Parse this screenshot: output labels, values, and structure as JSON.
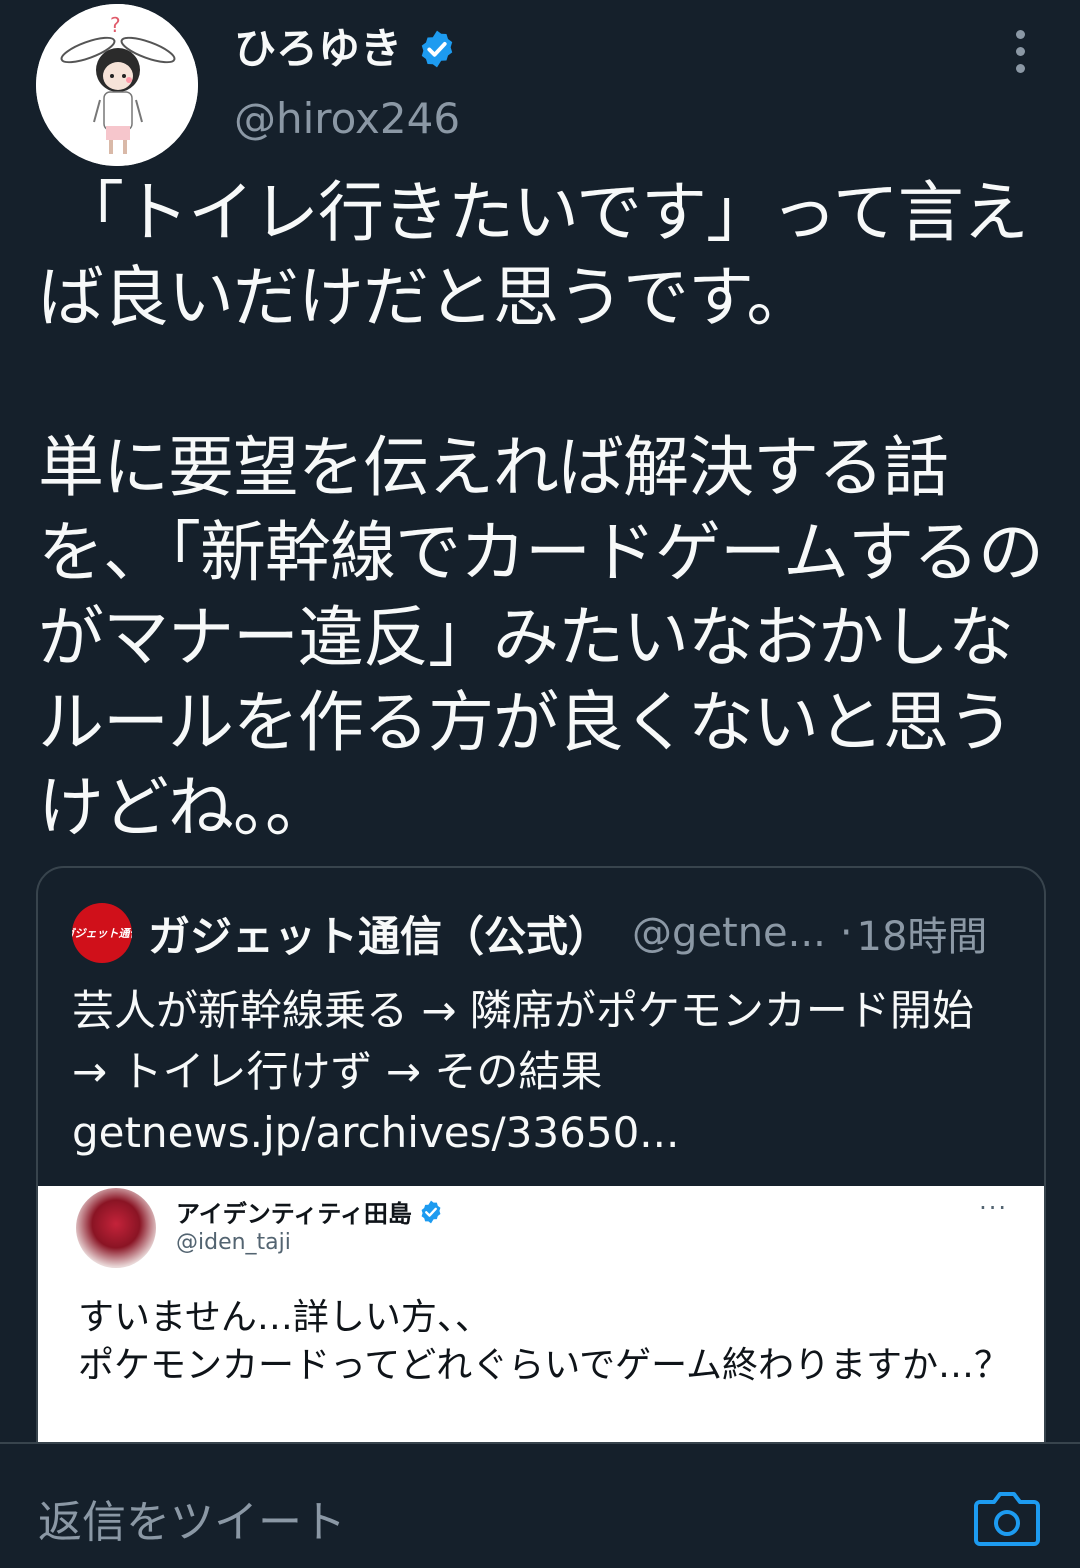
{
  "author": {
    "display_name": "ひろゆき",
    "handle": "@hirox246",
    "verified": true
  },
  "tweet": {
    "text": " 「トイレ行きたいです」って言えば良いだけだと思うです。\n\n単に要望を伝えれば解決する話を、「新幹線でカードゲームするのがマナー違反」みたいなおかしなルールを作る方が良くないと思うけどね。。"
  },
  "quote": {
    "avatar_text": "ガジェット通信",
    "display_name": "ガジェット通信（公式）",
    "handle": "@getne...",
    "separator": "·",
    "time": "18時間",
    "text": "芸人が新幹線乗る → 隣席がポケモンカード開始 → トイレ行けず → その結果 getnews.jp/archives/33650...",
    "image": {
      "display_name": "アイデンティティ田島",
      "handle": "@iden_taji",
      "more": "···",
      "text": "すいません…詳しい方、、\nポケモンカードってどれぐらいでゲーム終わりますか…？"
    }
  },
  "reply": {
    "placeholder": "返信をツイート"
  },
  "colors": {
    "background": "#15202b",
    "text": "#f7f9f9",
    "secondary": "#8b98a5",
    "accent": "#1d9bf0",
    "border": "#38444d"
  },
  "icons": {
    "verified": "verified-badge-icon",
    "more": "more-vertical-icon",
    "camera": "camera-icon"
  }
}
